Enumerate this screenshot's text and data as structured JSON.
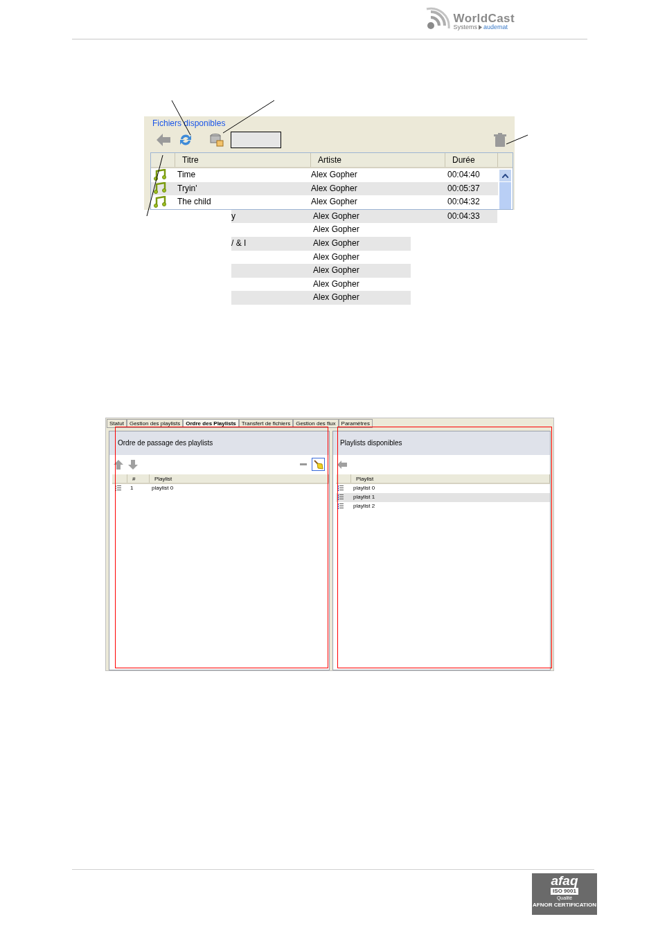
{
  "header": {
    "logo_name": "WorldCast",
    "logo_subtitle_left": "Systems",
    "logo_subtitle_right": "audemat"
  },
  "files_panel": {
    "title": "Fichiers disponibles",
    "columns": [
      "Titre",
      "Artiste",
      "Durée"
    ],
    "rows": [
      {
        "title": "Time",
        "artist": "Alex Gopher",
        "duration": "00:04:40"
      },
      {
        "title": "Tryin'",
        "artist": "Alex Gopher",
        "duration": "00:05:37"
      },
      {
        "title": "The child",
        "artist": "Alex Gopher",
        "duration": "00:04:32"
      },
      {
        "title": "y",
        "artist": "Alex Gopher",
        "duration": "00:04:33"
      },
      {
        "title": "",
        "artist": "Alex Gopher",
        "duration": ""
      },
      {
        "title": "/ & I",
        "artist": "Alex Gopher",
        "duration": ""
      },
      {
        "title": "",
        "artist": "Alex Gopher",
        "duration": ""
      },
      {
        "title": "",
        "artist": "Alex Gopher",
        "duration": ""
      },
      {
        "title": "",
        "artist": "Alex Gopher",
        "duration": ""
      },
      {
        "title": "",
        "artist": "Alex Gopher",
        "duration": ""
      }
    ]
  },
  "app": {
    "tabs": [
      {
        "label": "Statut",
        "selected": false
      },
      {
        "label": "Gestion des playlists",
        "selected": false
      },
      {
        "label": "Ordre des Playlists",
        "selected": true
      },
      {
        "label": "Transfert de fichiers",
        "selected": false
      },
      {
        "label": "Gestion des flux",
        "selected": false
      },
      {
        "label": "Paramètres",
        "selected": false
      }
    ],
    "order_panel": {
      "title": "Ordre de passage des playlists",
      "columns": [
        "#",
        "Playlist"
      ],
      "rows": [
        {
          "number": "1",
          "name": "playlist 0",
          "selected": false
        }
      ]
    },
    "available_panel": {
      "title": "Playlists disponibles",
      "columns": [
        "Playlist"
      ],
      "rows": [
        {
          "name": "playlist 0",
          "selected": false
        },
        {
          "name": "playlist 1",
          "selected": true
        },
        {
          "name": "playlist 2",
          "selected": false
        }
      ]
    }
  },
  "footer": {
    "badge_title": "afaq",
    "badge_standard": "ISO 9001",
    "badge_quality": "Qualité",
    "badge_issuer": "AFNOR CERTIFICATION"
  }
}
